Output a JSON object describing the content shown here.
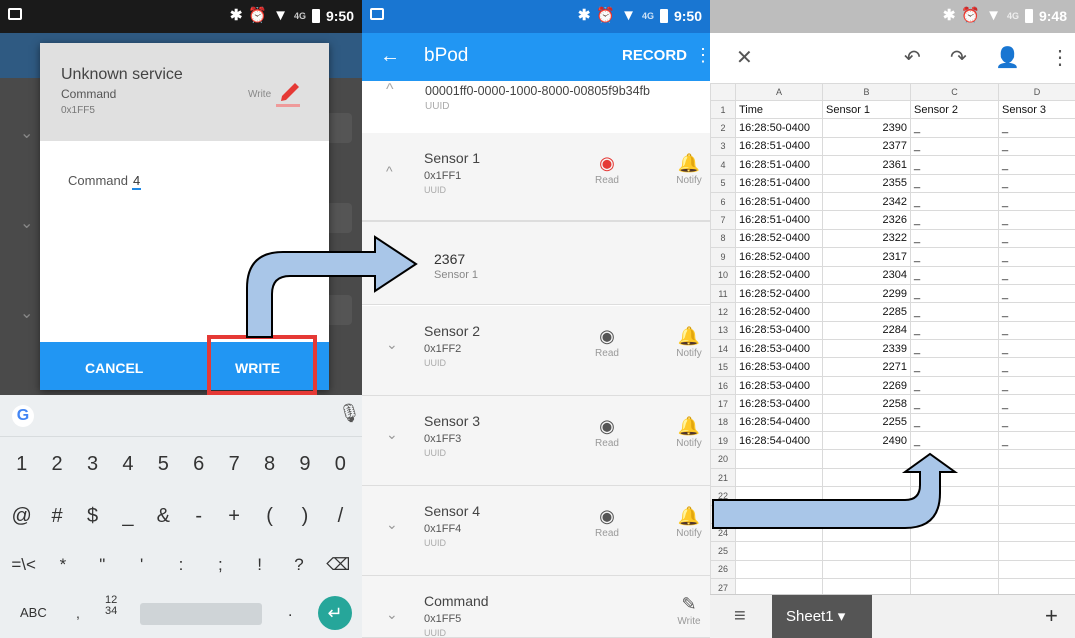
{
  "status_left": {
    "time": "9:50",
    "net": "4G"
  },
  "status_mid": {
    "time": "9:50",
    "net": "4G"
  },
  "status_right": {
    "time": "9:48",
    "net": "4G"
  },
  "dialog": {
    "title": "Unknown service",
    "subtitle": "Command",
    "uuid": "0x1FF5",
    "write_label": "Write",
    "field_label": "Command",
    "field_value": "4",
    "cancel": "CANCEL",
    "write": "WRITE"
  },
  "keyboard": {
    "row1": [
      "1",
      "2",
      "3",
      "4",
      "5",
      "6",
      "7",
      "8",
      "9",
      "0"
    ],
    "row2": [
      "@",
      "#",
      "$",
      "_",
      "&",
      "-",
      "+",
      "(",
      ")",
      "/"
    ],
    "row3": [
      "=\\<",
      "*",
      "\"",
      "'",
      ":",
      ";",
      "!",
      "?"
    ],
    "abc": "ABC",
    "comma": ",",
    "num_top": "12",
    "num_bottom": "34",
    "dot": "."
  },
  "app": {
    "title": "bPod",
    "record": "RECORD",
    "uuid_value": "00001ff0-0000-1000-8000-00805f9b34fb",
    "uuid_label": "UUID",
    "read": "Read",
    "notify": "Notify",
    "write": "Write",
    "services": [
      {
        "name": "Sensor 1",
        "id": "0x1FF1",
        "uuid": "UUID"
      },
      {
        "name": "Sensor 2",
        "id": "0x1FF2",
        "uuid": "UUID"
      },
      {
        "name": "Sensor 3",
        "id": "0x1FF3",
        "uuid": "UUID"
      },
      {
        "name": "Sensor 4",
        "id": "0x1FF4",
        "uuid": "UUID"
      },
      {
        "name": "Command",
        "id": "0x1FF5",
        "uuid": "UUID"
      }
    ],
    "sensor1_value": "2367",
    "sensor1_label": "Sensor 1"
  },
  "sheet": {
    "col_letters": [
      "A",
      "B",
      "C",
      "D"
    ],
    "headers": [
      "Time",
      "Sensor 1",
      "Sensor 2",
      "Sensor 3"
    ],
    "rows": [
      [
        "16:28:50-0400",
        "2390"
      ],
      [
        "16:28:51-0400",
        "2377"
      ],
      [
        "16:28:51-0400",
        "2361"
      ],
      [
        "16:28:51-0400",
        "2355"
      ],
      [
        "16:28:51-0400",
        "2342"
      ],
      [
        "16:28:51-0400",
        "2326"
      ],
      [
        "16:28:52-0400",
        "2322"
      ],
      [
        "16:28:52-0400",
        "2317"
      ],
      [
        "16:28:52-0400",
        "2304"
      ],
      [
        "16:28:52-0400",
        "2299"
      ],
      [
        "16:28:52-0400",
        "2285"
      ],
      [
        "16:28:53-0400",
        "2284"
      ],
      [
        "16:28:53-0400",
        "2339"
      ],
      [
        "16:28:53-0400",
        "2271"
      ],
      [
        "16:28:53-0400",
        "2269"
      ],
      [
        "16:28:53-0400",
        "2258"
      ],
      [
        "16:28:54-0400",
        "2255"
      ],
      [
        "16:28:54-0400",
        "2490"
      ]
    ],
    "blank_mark": "_",
    "tab_name": "Sheet1",
    "row_numbers": [
      "1",
      "2",
      "3",
      "4",
      "5",
      "6",
      "7",
      "8",
      "9",
      "10",
      "11",
      "12",
      "13",
      "14",
      "15",
      "16",
      "17",
      "18",
      "19",
      "20",
      "21",
      "22",
      "23",
      "24",
      "25",
      "26",
      "27"
    ]
  },
  "colors": {
    "blue": "#2196f3",
    "red": "#e53935",
    "arrow": "#a9c6e8"
  }
}
